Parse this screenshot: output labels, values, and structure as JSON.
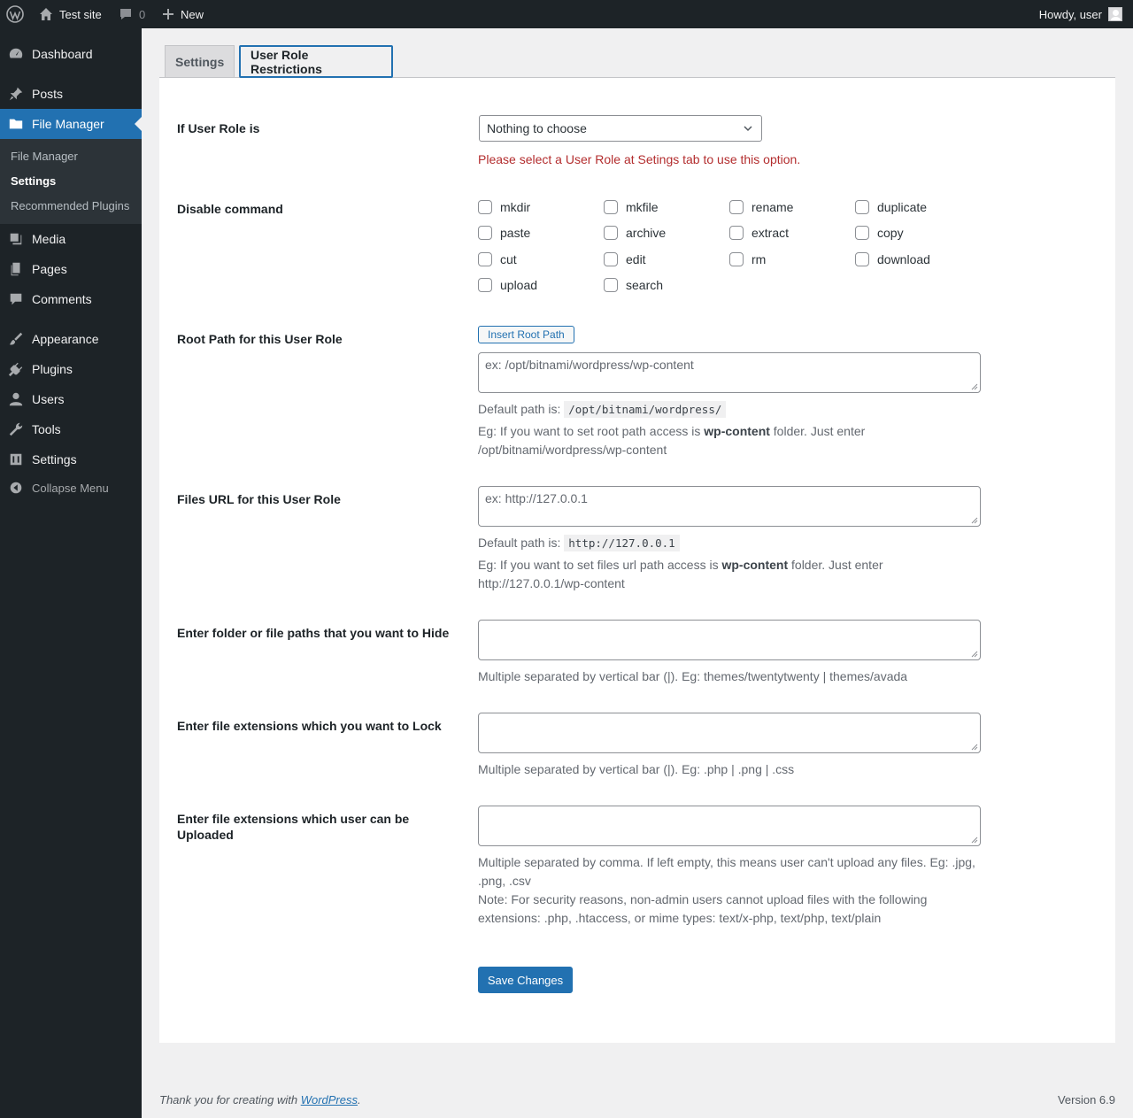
{
  "adminbar": {
    "site_name": "Test site",
    "comments_count": "0",
    "new_label": "New",
    "howdy": "Howdy, user"
  },
  "sidebar": {
    "items": [
      {
        "label": "Dashboard",
        "icon": "dashboard-icon"
      },
      {
        "label": "Posts",
        "icon": "pin-icon"
      },
      {
        "label": "File Manager",
        "icon": "folder-icon"
      },
      {
        "label": "Media",
        "icon": "media-icon"
      },
      {
        "label": "Pages",
        "icon": "pages-icon"
      },
      {
        "label": "Comments",
        "icon": "comment-icon"
      },
      {
        "label": "Appearance",
        "icon": "brush-icon"
      },
      {
        "label": "Plugins",
        "icon": "plug-icon"
      },
      {
        "label": "Users",
        "icon": "user-icon"
      },
      {
        "label": "Tools",
        "icon": "wrench-icon"
      },
      {
        "label": "Settings",
        "icon": "settings-icon"
      }
    ],
    "submenu": [
      "File Manager",
      "Settings",
      "Recommended Plugins"
    ],
    "collapse_label": "Collapse Menu"
  },
  "tabs": [
    "Settings",
    "User Role Restrictions"
  ],
  "form": {
    "role_label": "If User Role is",
    "role_select_value": "Nothing to choose",
    "role_error": "Please select a User Role at Setings tab to use this option.",
    "disable_label": "Disable command",
    "commands": [
      [
        "mkdir",
        "mkfile",
        "rename",
        "duplicate"
      ],
      [
        "paste",
        "archive",
        "extract",
        "copy"
      ],
      [
        "cut",
        "edit",
        "rm",
        "download"
      ],
      [
        "upload",
        "search"
      ]
    ],
    "root_label": "Root Path for this User Role",
    "insert_root_button": "Insert Root Path",
    "root_placeholder": "ex: /opt/bitnami/wordpress/wp-content",
    "root_default_prefix": "Default path is:",
    "root_default_value": "/opt/bitnami/wordpress/",
    "root_eg_before": "Eg: If you want to set root path access is",
    "root_eg_bold": "wp-content",
    "root_eg_after": "folder. Just enter",
    "root_eg_path": "/opt/bitnami/wordpress/wp-content",
    "url_label": "Files URL for this User Role",
    "url_placeholder": "ex: http://127.0.0.1",
    "url_default_prefix": "Default path is:",
    "url_default_value": "http://127.0.0.1",
    "url_eg_before": "Eg: If you want to set files url path access is",
    "url_eg_bold": "wp-content",
    "url_eg_after": "folder. Just enter",
    "url_eg_path": "http://127.0.0.1/wp-content",
    "hide_label": "Enter folder or file paths that you want to Hide",
    "hide_desc": "Multiple separated by vertical bar (|). Eg: themes/twentytwenty | themes/avada",
    "lock_label": "Enter file extensions which you want to Lock",
    "lock_desc": "Multiple separated by vertical bar (|). Eg: .php | .png | .css",
    "upload_label": "Enter file extensions which user can be Uploaded",
    "upload_desc": "Multiple separated by comma. If left empty, this means user can't upload any files. Eg: .jpg, .png, .csv",
    "upload_note": "Note: For security reasons, non-admin users cannot upload files with the following extensions: .php, .htaccess, or mime types: text/x-php, text/php, text/plain",
    "save_button": "Save Changes"
  },
  "footer": {
    "thanks_before": "Thank you for creating with",
    "thanks_link": "WordPress",
    "thanks_after": ".",
    "version": "Version 6.9"
  }
}
